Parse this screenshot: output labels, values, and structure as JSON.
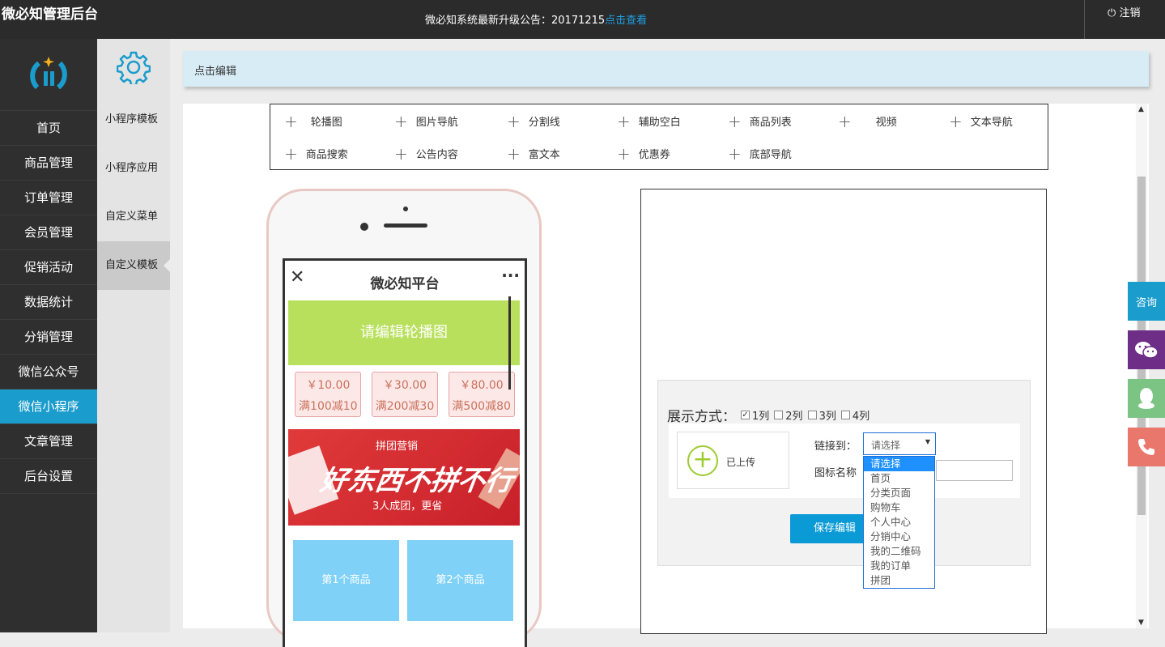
{
  "header": {
    "title": "微必知管理后台",
    "notice_text": "微必知系统最新升级公告：20171215",
    "notice_link": "点击查看",
    "logout": "注销"
  },
  "sidebar": {
    "items": [
      {
        "label": "首页"
      },
      {
        "label": "商品管理"
      },
      {
        "label": "订单管理"
      },
      {
        "label": "会员管理"
      },
      {
        "label": "促销活动"
      },
      {
        "label": "数据统计"
      },
      {
        "label": "分销管理"
      },
      {
        "label": "微信公众号"
      },
      {
        "label": "微信小程序",
        "active": true
      },
      {
        "label": "文章管理"
      },
      {
        "label": "后台设置"
      }
    ]
  },
  "subnav": {
    "items": [
      {
        "label": "小程序模板"
      },
      {
        "label": "小程序应用"
      },
      {
        "label": "自定义菜单"
      },
      {
        "label": "自定义模板",
        "active": true
      }
    ]
  },
  "editbar": {
    "label": "点击编辑"
  },
  "components": {
    "row1": [
      "轮播图",
      "图片导航",
      "分割线",
      "辅助空白",
      "商品列表",
      "视频",
      "文本导航"
    ],
    "row2": [
      "商品搜索",
      "公告内容",
      "富文本",
      "优惠券",
      "底部导航"
    ]
  },
  "phone": {
    "title": "微必知平台",
    "banner": "请编辑轮播图",
    "coupons": [
      {
        "amount": "￥10.00",
        "cond": "满100减10"
      },
      {
        "amount": "￥30.00",
        "cond": "满200减30"
      },
      {
        "amount": "￥80.00",
        "cond": "满500减80"
      }
    ],
    "promo": {
      "tag": "拼团营销",
      "main": "好东西不拼不行",
      "sub": "3人成团，更省"
    },
    "goods": [
      "第1个商品",
      "第2个商品"
    ]
  },
  "editor": {
    "display_label": "展示方式：",
    "columns": [
      {
        "label": "1列",
        "checked": true
      },
      {
        "label": "2列",
        "checked": false
      },
      {
        "label": "3列",
        "checked": false
      },
      {
        "label": "4列",
        "checked": false
      }
    ],
    "uploaded": "已上传",
    "link_label": "链接到：",
    "select_value": "请选择",
    "name_label": "图标名称",
    "save": "保存编辑",
    "options": [
      "请选择",
      "首页",
      "分类页面",
      "购物车",
      "个人中心",
      "分销中心",
      "我的二维码",
      "我的订单",
      "拼团"
    ]
  },
  "float": {
    "consult": "咨询"
  },
  "colors": {
    "accent": "#1a9ccc",
    "banner": "#b8e05c",
    "goods": "#7fd1f8"
  }
}
